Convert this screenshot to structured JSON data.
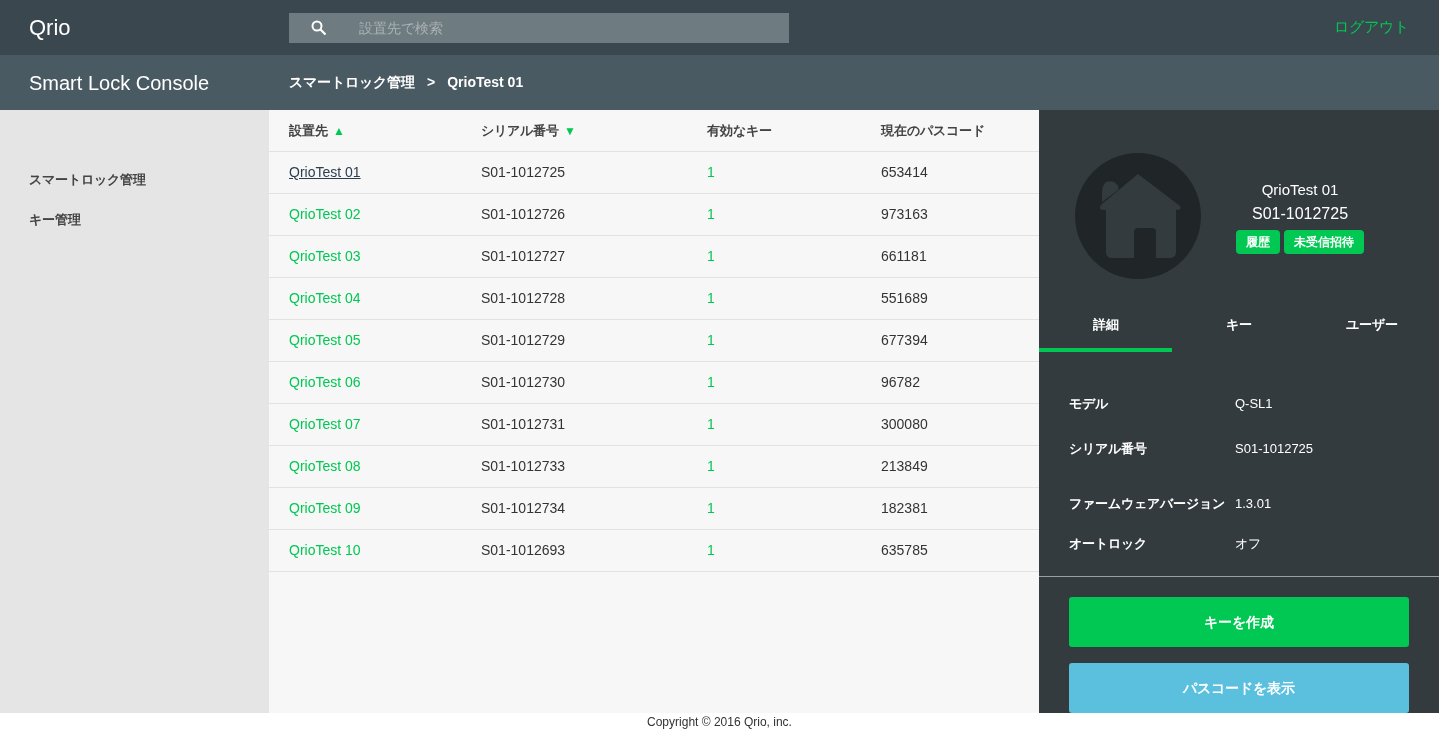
{
  "header": {
    "logo": "Qrio",
    "search": {
      "placeholder": "設置先で検索"
    },
    "logout": "ログアウト"
  },
  "subheader": {
    "title": "Smart Lock Console",
    "breadcrumb": [
      "スマートロック管理",
      "QrioTest 01"
    ],
    "separator": ">"
  },
  "sidebar": {
    "items": [
      {
        "label": "スマートロック管理"
      },
      {
        "label": "キー管理"
      }
    ]
  },
  "table": {
    "columns": [
      {
        "label": "設置先",
        "sort_arrow": "▲"
      },
      {
        "label": "シリアル番号",
        "sort_arrow": "▼"
      },
      {
        "label": "有効なキー"
      },
      {
        "label": "現在のパスコード"
      }
    ],
    "rows": [
      {
        "name": "QrioTest 01",
        "serial": "S01-1012725",
        "keys": "1",
        "passcode": "653414",
        "selected": true
      },
      {
        "name": "QrioTest 02",
        "serial": "S01-1012726",
        "keys": "1",
        "passcode": "973163",
        "selected": false
      },
      {
        "name": "QrioTest 03",
        "serial": "S01-1012727",
        "keys": "1",
        "passcode": "661181",
        "selected": false
      },
      {
        "name": "QrioTest 04",
        "serial": "S01-1012728",
        "keys": "1",
        "passcode": "551689",
        "selected": false
      },
      {
        "name": "QrioTest 05",
        "serial": "S01-1012729",
        "keys": "1",
        "passcode": "677394",
        "selected": false
      },
      {
        "name": "QrioTest 06",
        "serial": "S01-1012730",
        "keys": "1",
        "passcode": "96782",
        "selected": false
      },
      {
        "name": "QrioTest 07",
        "serial": "S01-1012731",
        "keys": "1",
        "passcode": "300080",
        "selected": false
      },
      {
        "name": "QrioTest 08",
        "serial": "S01-1012733",
        "keys": "1",
        "passcode": "213849",
        "selected": false
      },
      {
        "name": "QrioTest 09",
        "serial": "S01-1012734",
        "keys": "1",
        "passcode": "182381",
        "selected": false
      },
      {
        "name": "QrioTest 10",
        "serial": "S01-1012693",
        "keys": "1",
        "passcode": "635785",
        "selected": false
      }
    ]
  },
  "detail": {
    "name": "QrioTest 01",
    "serial": "S01-1012725",
    "badges": [
      "履歴",
      "未受信招待"
    ],
    "tabs": [
      {
        "label": "詳細",
        "selected": true
      },
      {
        "label": "キー",
        "selected": false
      },
      {
        "label": "ユーザー",
        "selected": false
      }
    ],
    "fields": [
      {
        "label": "モデル",
        "value": "Q-SL1"
      },
      {
        "label": "シリアル番号",
        "value": "S01-1012725"
      },
      {
        "label": "ファームウェアバージョン",
        "value": "1.3.01"
      },
      {
        "label": "オートロック",
        "value": "オフ"
      }
    ],
    "buttons": [
      {
        "label": "キーを作成",
        "kind": "primary"
      },
      {
        "label": "パスコードを表示",
        "kind": "secondary"
      }
    ]
  },
  "footer": "Copyright © 2016 Qrio, inc."
}
